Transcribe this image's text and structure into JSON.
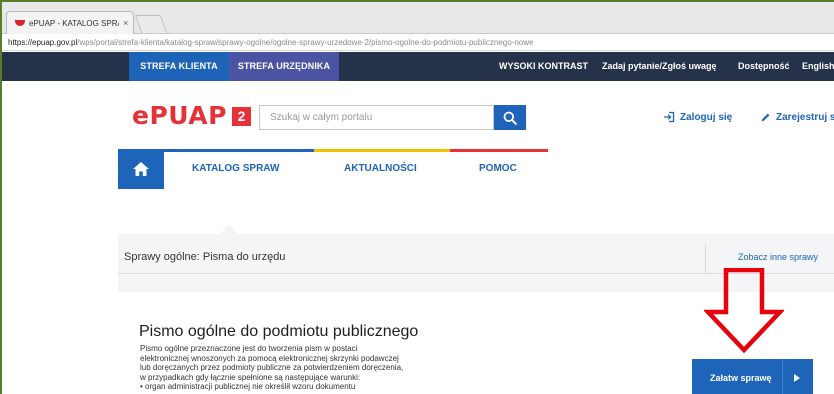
{
  "browser": {
    "tab_title": "ePUAP - KATALOG SPRAW",
    "tab_close": "×",
    "url_host": "https://epuap.gov.pl",
    "url_path": "/wps/portal/strefa-klienta/katalog-spraw/sprawy-ogolne/ogolne-sprawy-urzedowe-2/pismo-ogolne-do-podmiotu-publicznego-nowe"
  },
  "topbar": {
    "tab_klient": "STREFA KLIENTA",
    "tab_urzednik": "STREFA URZĘDNIKA",
    "high_contrast": "WYSOKI KONTRAST",
    "ask_question": "Zadaj pytanie/Zgłoś uwagę",
    "accessibility": "Dostępność",
    "english": "English"
  },
  "header": {
    "logo_text": "ePUAP",
    "logo_number": "2",
    "search_placeholder": "Szukaj w całym portalu",
    "login": "Zaloguj się",
    "register": "Zarejestruj się"
  },
  "nav": {
    "items": [
      "KATALOG SPRAW",
      "AKTUALNOŚCI",
      "POMOC"
    ],
    "accent_colors": [
      "#1e64b9",
      "#f2c200",
      "#e53238"
    ]
  },
  "section": {
    "title": "Sprawy ogólne: Pisma do urzędu",
    "other_link": "Zobacz inne sprawy"
  },
  "document": {
    "title": "Pismo ogólne do podmiotu publicznego",
    "description_lines": [
      "Pismo ogólne przeznaczone jest do tworzenia pism w postaci",
      "elektronicznej wnoszonych za pomocą elektronicznej skrzynki podawczej",
      "lub doręczanych przez podmioty publiczne za potwierdzeniem doręczenia,",
      "w przypadkach gdy łącznie spełnione są następujące warunki:",
      "• organ administracji publicznej nie określił wzoru dokumentu"
    ],
    "cta_label": "Załatw sprawę"
  },
  "colors": {
    "primary": "#1e64b9",
    "logo_red": "#e53238",
    "topbar": "#25324a",
    "annotation_red": "#e8000b"
  }
}
